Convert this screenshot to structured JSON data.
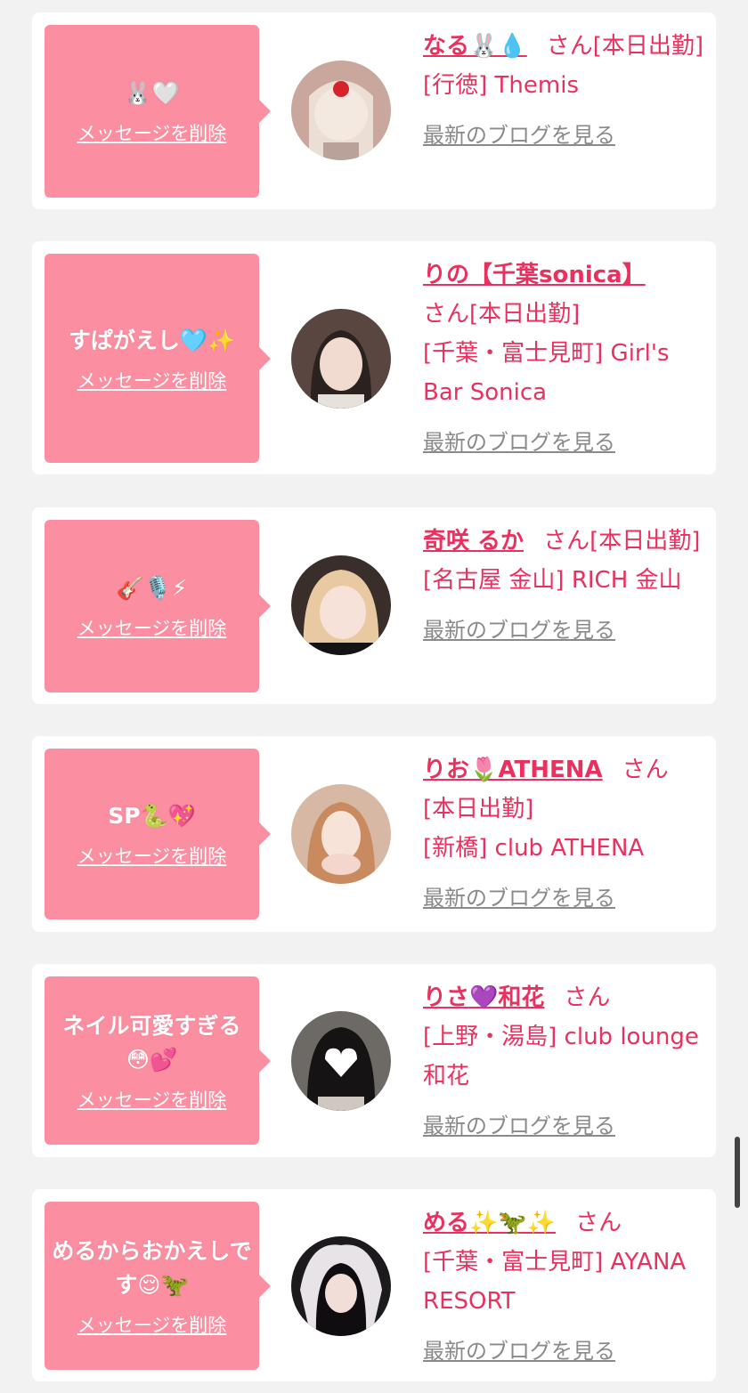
{
  "delete_label": "メッセージを削除",
  "blog_label": "最新のブログを見る",
  "san_label": "さん",
  "cards": [
    {
      "message": "🐰🤍",
      "name": "なる🐰💧",
      "status": "[本日出勤]",
      "shop": "[行徳] Themis"
    },
    {
      "message": "すぱがえし🩵✨",
      "name": "りの【千葉sonica】",
      "status": "[本日出勤]",
      "shop": "[千葉・富士見町] Girl's Bar Sonica"
    },
    {
      "message": "🎸🎙️⚡",
      "name": "奇咲 るか",
      "status": "[本日出勤]",
      "shop": "[名古屋 金山] RICH 金山"
    },
    {
      "message": "SP🐍💖",
      "name": "りお🌷ATHENA",
      "status": "[本日出勤]",
      "shop": "[新橋] club ATHENA"
    },
    {
      "message": "ネイル可愛すぎる😳💕",
      "name": "りさ💜和花",
      "status": "",
      "shop": "[上野・湯島] club lounge 和花"
    },
    {
      "message": "めるからおかえしです😌🦖",
      "name": "める✨🦖✨",
      "status": "",
      "shop": "[千葉・富士見町] AYANA RESORT"
    }
  ]
}
